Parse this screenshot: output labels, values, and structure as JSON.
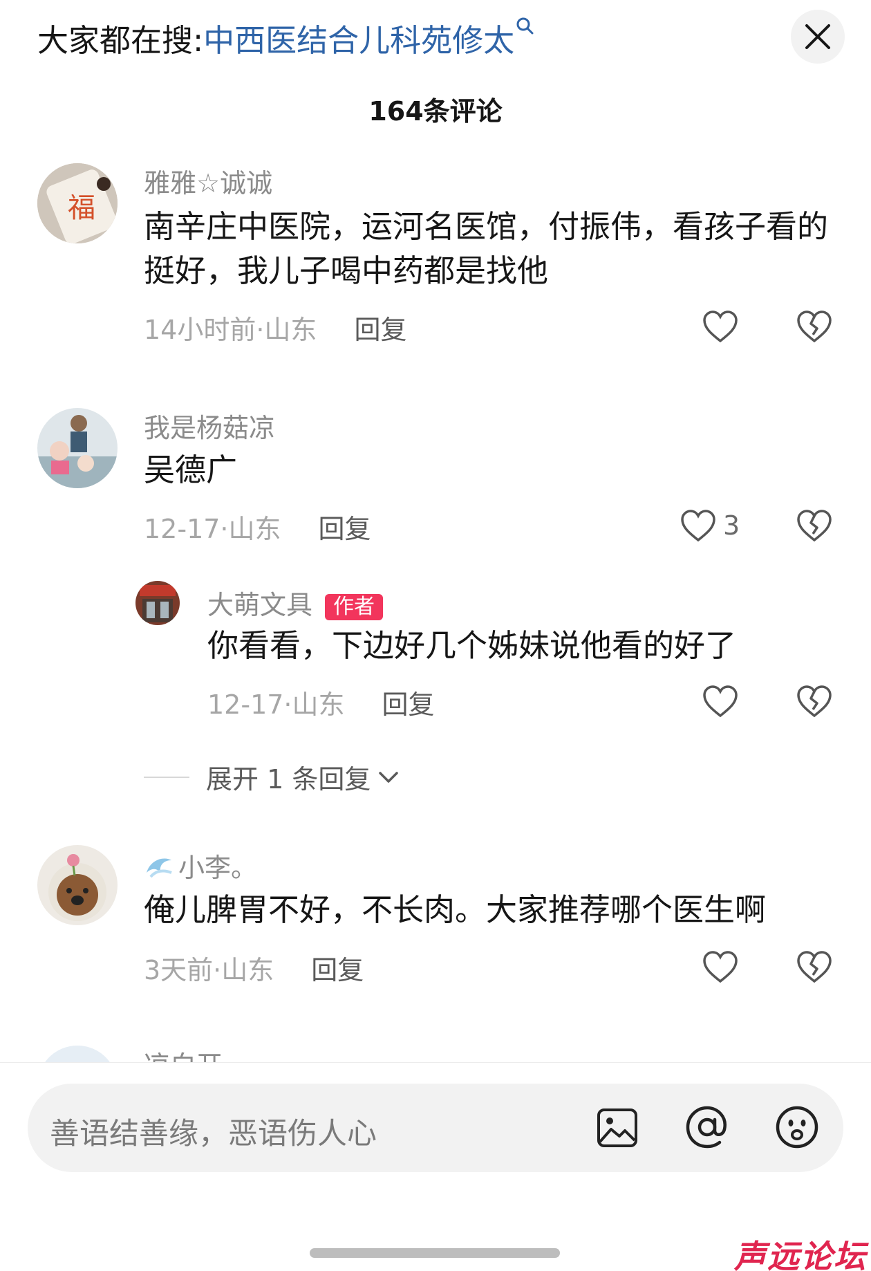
{
  "search": {
    "prefix": "大家都在搜:",
    "query": "中西医结合儿科苑修太",
    "query_icon": "search-icon"
  },
  "header": {
    "comment_count": "164条评论",
    "close_icon": "close-icon"
  },
  "comments": [
    {
      "username": "雅雅☆诚诚",
      "text": "南辛庄中医院，运河名医馆，付振伟，看孩子看的挺好，我儿子喝中药都是找他",
      "meta": "14小时前·山东",
      "reply": "回复",
      "likes": ""
    },
    {
      "username": "我是杨菇凉",
      "text": "吴德广",
      "meta": "12-17·山东",
      "reply": "回复",
      "likes": "3",
      "sub_reply": {
        "username": "大萌文具",
        "badge": "作者",
        "text": "你看看，下边好几个姊妹说他看的好了",
        "meta": "12-17·山东",
        "reply": "回复"
      },
      "expand_label": "展开 1 条回复"
    },
    {
      "username": "小李。",
      "text": "俺儿脾胃不好，不长肉。大家推荐哪个医生啊",
      "meta": "3天前·山东",
      "reply": "回复",
      "likes": ""
    },
    {
      "username": "凉白开"
    }
  ],
  "input": {
    "placeholder": "善语结善缘，恶语伤人心",
    "icons": [
      "image-icon",
      "at-icon",
      "emoji-icon"
    ]
  },
  "watermark": "声远论坛",
  "colors": {
    "link": "#2f64a8",
    "author_badge": "#f2355c",
    "watermark": "#e0254f"
  }
}
